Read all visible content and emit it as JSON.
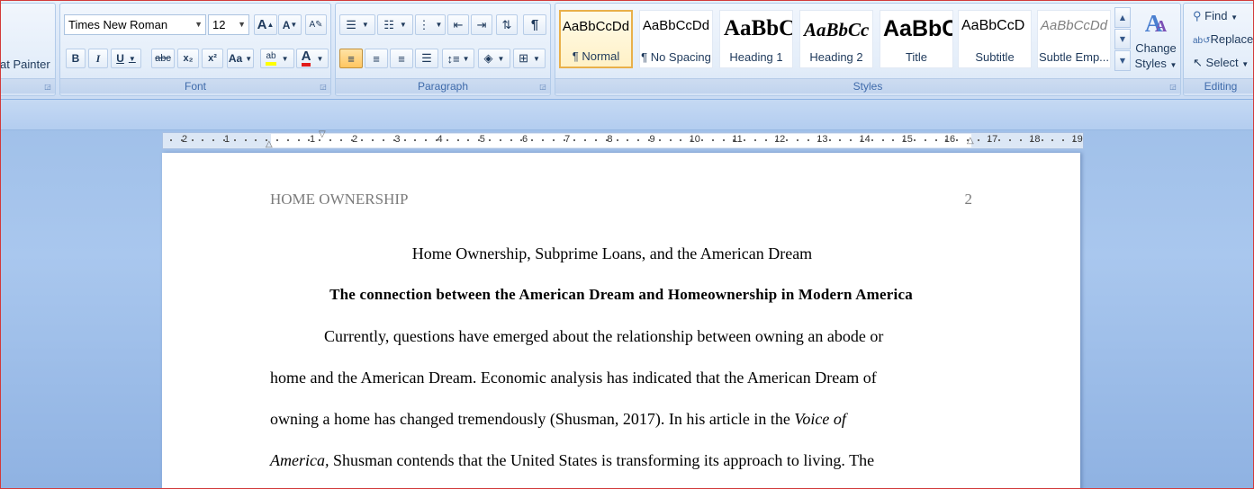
{
  "clipboard": {
    "format_painter_label": "at Painter"
  },
  "font": {
    "group_label": "Font",
    "family": "Times New Roman",
    "size": "12",
    "grow_label": "A",
    "shrink_label": "A",
    "bold_label": "B",
    "italic_label": "I",
    "underline_label": "U",
    "strike_label": "abc",
    "subscript_label": "x₂",
    "superscript_label": "x²",
    "case_label": "Aa",
    "highlight_label": "ab",
    "color_label": "A",
    "highlight_color": "#ffff00",
    "font_color": "#e11a1a"
  },
  "paragraph": {
    "group_label": "Paragraph",
    "pilcrow": "¶"
  },
  "styles": {
    "group_label": "Styles",
    "items": [
      {
        "sample": "AaBbCcDd",
        "name": "¶ Normal"
      },
      {
        "sample": "AaBbCcDd",
        "name": "¶ No Spacing"
      },
      {
        "sample": "AaBbC",
        "name": "Heading 1"
      },
      {
        "sample": "AaBbCc",
        "name": "Heading 2"
      },
      {
        "sample": "AaBbC",
        "name": "Title"
      },
      {
        "sample": "AaBbCcD",
        "name": "Subtitle"
      },
      {
        "sample": "AaBbCcDd",
        "name": "Subtle Emp..."
      }
    ],
    "change_styles_line1": "Change",
    "change_styles_line2": "Styles"
  },
  "editing": {
    "group_label": "Editing",
    "find": "Find",
    "replace": "Replace",
    "select": "Select"
  },
  "ruler": {
    "left_labels": [
      "2",
      "1"
    ],
    "right_labels": [
      "1",
      "2",
      "3",
      "4",
      "5",
      "6",
      "7",
      "8",
      "9",
      "10",
      "11",
      "12",
      "13",
      "14",
      "15",
      "16",
      "17",
      "18",
      "19"
    ]
  },
  "document": {
    "running_head": "HOME OWNERSHIP",
    "page_number": "2",
    "title": "Home Ownership, Subprime Loans, and the American Dream",
    "heading": "The connection between the American Dream and Homeownership in Modern America",
    "line1": "Currently, questions have emerged about the relationship between owning an abode or",
    "line2": "home and the American Dream. Economic analysis has indicated that the American Dream of",
    "line3_a": "owning a home has changed tremendously (Shusman, 2017). In his article in the ",
    "line3_b": "Voice of",
    "line4_a": "America,",
    "line4_b": " Shusman contends that the United States is transforming its approach to living. The"
  }
}
